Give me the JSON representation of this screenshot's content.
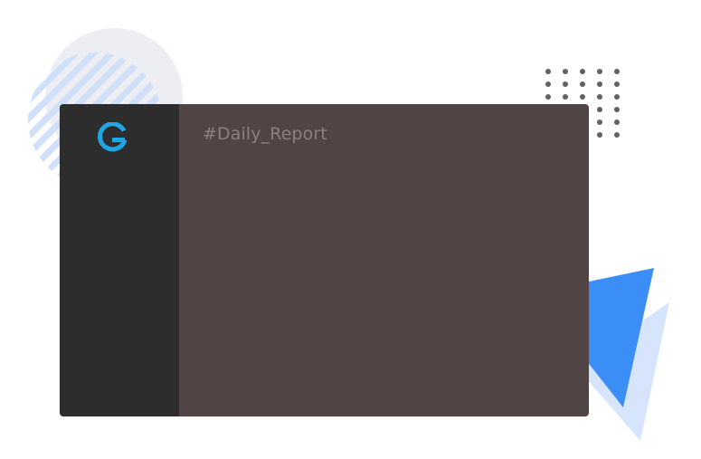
{
  "app": {
    "logo_icon": "g-logo-icon",
    "logo_color": "#1ea7e4"
  },
  "channel": {
    "title": "#Daily_Report"
  },
  "colors": {
    "sidebar_bg": "#2d2d2d",
    "content_bg": "#514444",
    "title_text": "#8c8080",
    "accent_blue": "#3b8ef5",
    "accent_blue_light": "#d6e5fc"
  }
}
